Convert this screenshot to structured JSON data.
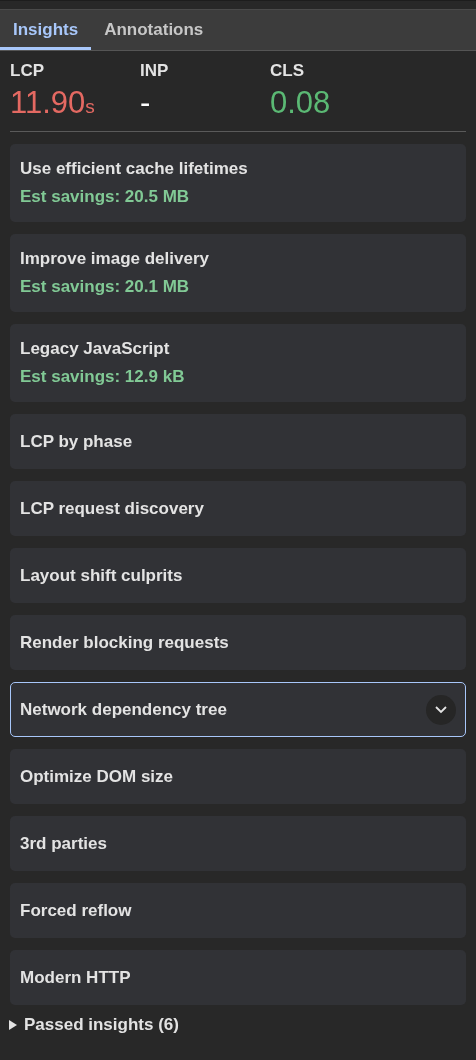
{
  "tabs": [
    {
      "label": "Insights",
      "selected": true
    },
    {
      "label": "Annotations",
      "selected": false
    }
  ],
  "metrics": [
    {
      "label": "LCP",
      "value": "11.90",
      "unit": "s",
      "color": "#e46962"
    },
    {
      "label": "INP",
      "value": "-",
      "color": "#ffffff"
    },
    {
      "label": "CLS",
      "value": "0.08",
      "color": "#5bb974"
    }
  ],
  "insights": [
    {
      "title": "Use efficient cache lifetimes",
      "savings": "Est savings: 20.5 MB",
      "selected": false
    },
    {
      "title": "Improve image delivery",
      "savings": "Est savings: 20.1 MB",
      "selected": false
    },
    {
      "title": "Legacy JavaScript",
      "savings": "Est savings: 12.9 kB",
      "selected": false
    },
    {
      "title": "LCP by phase",
      "selected": false
    },
    {
      "title": "LCP request discovery",
      "selected": false
    },
    {
      "title": "Layout shift culprits",
      "selected": false
    },
    {
      "title": "Render blocking requests",
      "selected": false
    },
    {
      "title": "Network dependency tree",
      "selected": true
    },
    {
      "title": "Optimize DOM size",
      "selected": false
    },
    {
      "title": "3rd parties",
      "selected": false
    },
    {
      "title": "Forced reflow",
      "selected": false
    },
    {
      "title": "Modern HTTP",
      "selected": false
    }
  ],
  "passed": {
    "label": "Passed insights (6)",
    "expanded": false
  }
}
